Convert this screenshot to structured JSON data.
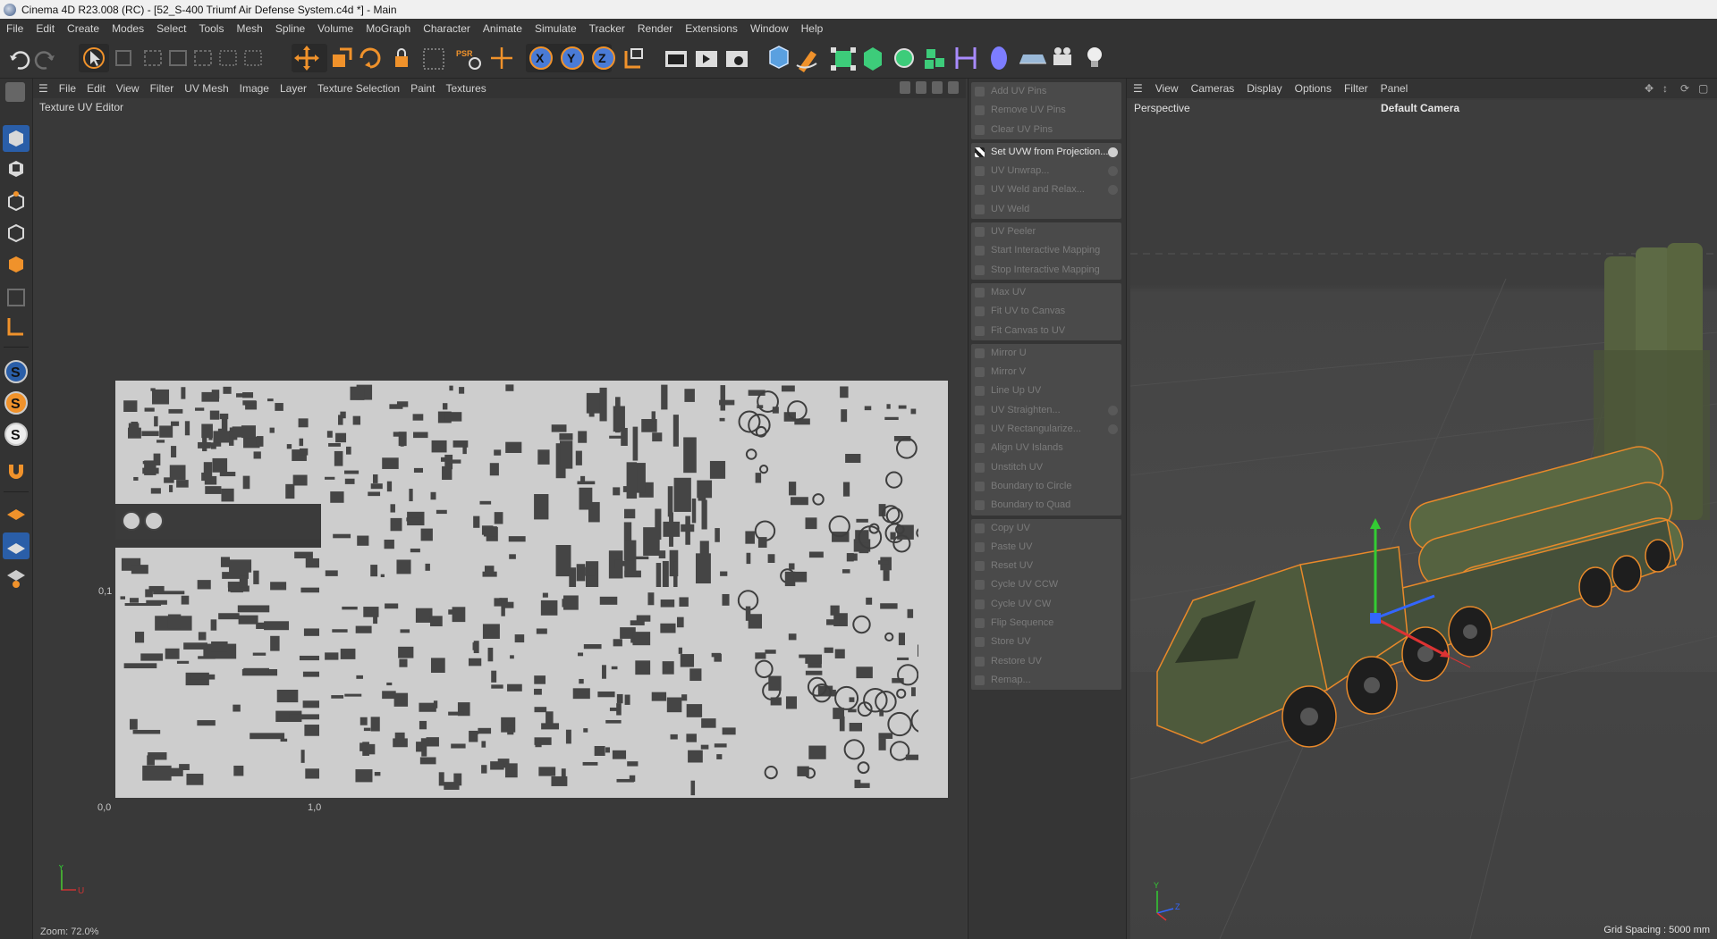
{
  "window": {
    "title": "Cinema 4D R23.008 (RC) - [52_S-400 Triumf Air Defense System.c4d *] - Main"
  },
  "menubar": [
    "File",
    "Edit",
    "Create",
    "Modes",
    "Select",
    "Tools",
    "Mesh",
    "Spline",
    "Volume",
    "MoGraph",
    "Character",
    "Animate",
    "Simulate",
    "Tracker",
    "Render",
    "Extensions",
    "Window",
    "Help"
  ],
  "toolbar": {
    "axis_buttons": [
      "X",
      "Y",
      "Z"
    ],
    "psr_label": "PSR",
    "icons": [
      "undo-icon",
      "redo-icon",
      "live-selection-icon",
      "cube-outline-icon",
      "rect-selection-icon",
      "move-arrows-icon",
      "move-icon",
      "scale-icon",
      "rotate-icon",
      "lock-icon",
      "psr-icon",
      "transform-icon",
      "x-axis-icon",
      "y-axis-icon",
      "z-axis-icon",
      "coordinate-icon",
      "render-view-icon",
      "render-picture-queue-icon",
      "render-settings-icon",
      "cube-icon",
      "pen-icon",
      "generator-icon",
      "subdivision-icon",
      "mograph-cloner-icon",
      "mograph-cubes-icon",
      "deformer-icon",
      "spline-blob-icon",
      "floor-icon",
      "camera-icon",
      "light-bulb-icon"
    ],
    "colors": {
      "accent_orange": "#f0922b",
      "axis_blue": "#4a7bd6"
    }
  },
  "uv_editor": {
    "menus": [
      "View",
      "Edit",
      "View",
      "Filter",
      "UV Mesh",
      "Image",
      "Layer",
      "Texture Selection",
      "Paint",
      "Textures"
    ],
    "menu_file": "File",
    "title": "Texture UV Editor",
    "label_origin": "0,0",
    "label_one": "1,0",
    "label_y": "0,1",
    "zoom": "Zoom: 72.0%",
    "axis_y": "Y",
    "axis_u": "U"
  },
  "uv_commands": [
    {
      "label": "Add UV Pins",
      "active": false,
      "gear": false
    },
    {
      "label": "Remove UV Pins",
      "active": false,
      "gear": false
    },
    {
      "label": "Clear UV Pins",
      "active": false,
      "gear": false
    },
    {
      "label": "Set UVW from Projection...",
      "active": true,
      "gear": true
    },
    {
      "label": "UV Unwrap...",
      "active": false,
      "gear": true
    },
    {
      "label": "UV Weld and Relax...",
      "active": false,
      "gear": true
    },
    {
      "label": "UV Weld",
      "active": false,
      "gear": false
    },
    {
      "label": "UV Peeler",
      "active": false,
      "gear": false
    },
    {
      "label": "Start Interactive Mapping",
      "active": false,
      "gear": false
    },
    {
      "label": "Stop Interactive Mapping",
      "active": false,
      "gear": false
    },
    {
      "label": "Max UV",
      "active": false,
      "gear": false
    },
    {
      "label": "Fit UV to Canvas",
      "active": false,
      "gear": false
    },
    {
      "label": "Fit Canvas to UV",
      "active": false,
      "gear": false
    },
    {
      "label": "Mirror U",
      "active": false,
      "gear": false
    },
    {
      "label": "Mirror V",
      "active": false,
      "gear": false
    },
    {
      "label": "Line Up UV",
      "active": false,
      "gear": false
    },
    {
      "label": "UV Straighten...",
      "active": false,
      "gear": true
    },
    {
      "label": "UV Rectangularize...",
      "active": false,
      "gear": true
    },
    {
      "label": "Align UV Islands",
      "active": false,
      "gear": false
    },
    {
      "label": "Unstitch UV",
      "active": false,
      "gear": false
    },
    {
      "label": "Boundary to Circle",
      "active": false,
      "gear": false
    },
    {
      "label": "Boundary to Quad",
      "active": false,
      "gear": false
    },
    {
      "label": "Copy UV",
      "active": false,
      "gear": false
    },
    {
      "label": "Paste UV",
      "active": false,
      "gear": false
    },
    {
      "label": "Reset UV",
      "active": false,
      "gear": false
    },
    {
      "label": "Cycle UV CCW",
      "active": false,
      "gear": false
    },
    {
      "label": "Cycle UV CW",
      "active": false,
      "gear": false
    },
    {
      "label": "Flip Sequence",
      "active": false,
      "gear": false
    },
    {
      "label": "Store UV",
      "active": false,
      "gear": false
    },
    {
      "label": "Restore UV",
      "active": false,
      "gear": false
    },
    {
      "label": "Remap...",
      "active": false,
      "gear": false
    }
  ],
  "viewport": {
    "menus": [
      "View",
      "Cameras",
      "Display",
      "Options",
      "Filter",
      "Panel"
    ],
    "view_name": "Perspective",
    "camera": "Default Camera",
    "grid_spacing": "Grid Spacing : 5000 mm",
    "axis_y": "Y",
    "axis_z": "Z",
    "colors": {
      "vehicle_green": "#4f5b3e",
      "selection_outline": "#e8892a",
      "axis_x": "#d33",
      "axis_y": "#3c3",
      "axis_z": "#36f"
    }
  }
}
